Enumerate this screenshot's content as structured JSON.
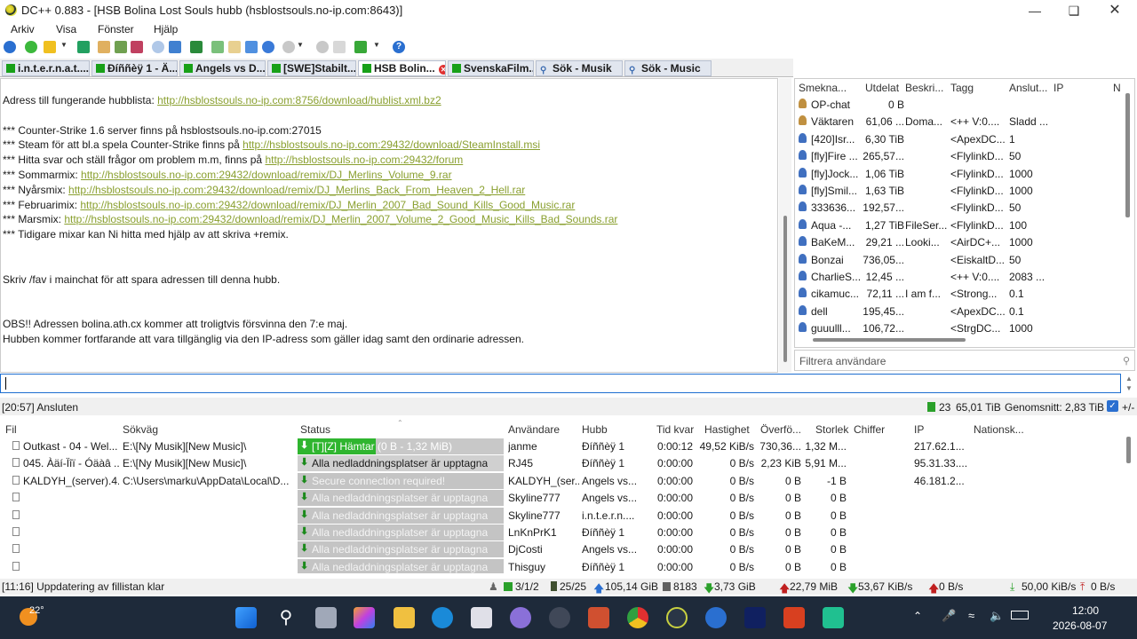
{
  "window": {
    "title": "DC++ 0.883 - [HSB Bolina Lost Souls hubb (hsblostsouls.no-ip.com:8643)]"
  },
  "menu": [
    "Arkiv",
    "Visa",
    "Fönster",
    "Hjälp"
  ],
  "tabs": [
    {
      "label": "i.n.t.e.r.n.a.t....",
      "kind": "hub"
    },
    {
      "label": "Ðíññèÿ 1 - Ä...",
      "kind": "hub"
    },
    {
      "label": "Angels vs D...",
      "kind": "hub"
    },
    {
      "label": "[SWE]Stabilt...",
      "kind": "hub"
    },
    {
      "label": "HSB Bolin...",
      "kind": "hub",
      "active": true
    },
    {
      "label": "SvenskaFilm...",
      "kind": "hub"
    },
    {
      "label": "Sök - Musik",
      "kind": "search"
    },
    {
      "label": "Sök - Music",
      "kind": "search"
    }
  ],
  "chat": {
    "lines": [
      {
        "t": "Adress till fungerande hubblista: ",
        "link": "http://hsblostsouls.no-ip.com:8756/download/hublist.xml.bz2"
      },
      {
        "t": ""
      },
      {
        "t": "*** Counter-Strike 1.6 server finns på hsblostsouls.no-ip.com:27015"
      },
      {
        "t": "*** Steam för att bl.a spela Counter-Strike finns på ",
        "link": "http://hsblostsouls.no-ip.com:29432/download/SteamInstall.msi"
      },
      {
        "t": "*** Hitta svar och ställ frågor om problem m.m, finns på ",
        "link": "http://hsblostsouls.no-ip.com:29432/forum"
      },
      {
        "t": "*** Sommarmix: ",
        "link": "http://hsblostsouls.no-ip.com:29432/download/remix/DJ_Merlins_Volume_9.rar"
      },
      {
        "t": "*** Nyårsmix: ",
        "link": "http://hsblostsouls.no-ip.com:29432/download/remix/DJ_Merlins_Back_From_Heaven_2_Hell.rar"
      },
      {
        "t": "*** Februarimix: ",
        "link": "http://hsblostsouls.no-ip.com:29432/download/remix/DJ_Merlin_2007_Bad_Sound_Kills_Good_Music.rar"
      },
      {
        "t": "*** Marsmix: ",
        "link": "http://hsblostsouls.no-ip.com:29432/download/remix/DJ_Merlin_2007_Volume_2_Good_Music_Kills_Bad_Sounds.rar"
      },
      {
        "t": "*** Tidigare mixar kan Ni hitta med hjälp av att skriva +remix."
      },
      {
        "t": ""
      },
      {
        "t": ""
      },
      {
        "t": "Skriv /fav i mainchat för att spara adressen till denna hubb."
      },
      {
        "t": ""
      },
      {
        "t": ""
      },
      {
        "t": "OBS!! Adressen bolina.ath.cx kommer att troligtvis försvinna den 7:e maj."
      },
      {
        "t": "Hubben kommer fortfarande att vara tillgänglig via den IP-adress som gäller idag samt den ordinarie adressen."
      }
    ]
  },
  "users": {
    "headers": [
      "Smekna...",
      "Utdelat",
      "Beskri...",
      "Tagg",
      "Anslut...",
      "IP",
      "N"
    ],
    "rows": [
      [
        "OP-chat",
        "0 B",
        "",
        "",
        "",
        ""
      ],
      [
        "Väktaren",
        "61,06 ...",
        "Doma...",
        "<++ V:0....",
        "Sladd ...",
        ""
      ],
      [
        "[420]Isr...",
        "6,30 TiB",
        "",
        "<ApexDC...",
        "1",
        ""
      ],
      [
        "[fly]Fire ...",
        "265,57...",
        "",
        "<FlylinkD...",
        "50",
        ""
      ],
      [
        "[fly]Jock...",
        "1,06 TiB",
        "",
        "<FlylinkD...",
        "1000",
        ""
      ],
      [
        "[fly]Smil...",
        "1,63 TiB",
        "",
        "<FlylinkD...",
        "1000",
        ""
      ],
      [
        "333636...",
        "192,57...",
        "",
        "<FlylinkD...",
        "50",
        ""
      ],
      [
        "Aqua -...",
        "1,27 TiB",
        "FileSer...",
        "<FlylinkD...",
        "100",
        ""
      ],
      [
        "BaKeM...",
        "29,21 ...",
        "Looki...",
        "<AirDC+...",
        "1000",
        ""
      ],
      [
        "Bonzai",
        "736,05...",
        "",
        "<EiskaltD...",
        "50",
        ""
      ],
      [
        "CharlieS...",
        "12,45 ...",
        "",
        "<++ V:0....",
        "2083 ...",
        ""
      ],
      [
        "cikamuc...",
        "72,11 ...",
        "I am f...",
        "<Strong...",
        "0.1",
        ""
      ],
      [
        "dell",
        "195,45...",
        "",
        "<ApexDC...",
        "0.1",
        ""
      ],
      [
        "guuulll...",
        "106,72...",
        "",
        "<StrgDC...",
        "1000",
        ""
      ]
    ],
    "filter_placeholder": "Filtrera användare"
  },
  "status_top": {
    "time_msg": "[20:57] Ansluten",
    "users": "23",
    "shared": "65,01 TiB",
    "avg": "Genomsnitt: 2,83 TiB",
    "plusminus": "+/-"
  },
  "transfers": {
    "headers": [
      "Fil",
      "Sökväg",
      "Status",
      "Användare",
      "Hubb",
      "Tid kvar",
      "Hastighet",
      "Överfö...",
      "Storlek",
      "Chiffer",
      "IP",
      "Nationsk..."
    ],
    "rows": [
      {
        "fil": "Outkast - 04 - Wel...",
        "path": "E:\\[Ny Musik][New Music]\\",
        "status": "[T][Z] Hämtar (0 B - 1,32 MiB)",
        "kind": "active",
        "progress": 0.38,
        "user": "janme",
        "hub": "Ðíññèÿ 1",
        "left": "0:00:12",
        "speed": "49,52 KiB/s",
        "trans": "730,36...",
        "size": "1,32 M...",
        "ip": "217.62.1..."
      },
      {
        "fil": "045. Àäí-Ïîï - Óäàâ ...",
        "path": "E:\\[Ny Musik][New Music]\\",
        "status": "Alla nedladdningsplatser är upptagna",
        "kind": "waiting",
        "user": "RJ45",
        "hub": "Ðíññèÿ 1",
        "left": "0:00:00",
        "speed": "0 B/s",
        "trans": "2,23 KiB",
        "size": "5,91 M...",
        "ip": "95.31.33...."
      },
      {
        "fil": "KALDYH_(server).4...",
        "path": "C:\\Users\\marku\\AppData\\Local\\D...",
        "status": "Secure connection required!",
        "kind": "error",
        "user": "KALDYH_(ser...",
        "hub": "Angels vs...",
        "left": "0:00:00",
        "speed": "0 B/s",
        "trans": "0 B",
        "size": "-1 B",
        "ip": "46.181.2..."
      },
      {
        "fil": "",
        "path": "",
        "status": "Alla nedladdningsplatser är upptagna",
        "kind": "grey",
        "user": "Skyline777",
        "hub": "Angels vs...",
        "left": "0:00:00",
        "speed": "0 B/s",
        "trans": "0 B",
        "size": "0 B",
        "ip": ""
      },
      {
        "fil": "",
        "path": "",
        "status": "Alla nedladdningsplatser är upptagna",
        "kind": "grey",
        "user": "Skyline777",
        "hub": "i.n.t.e.r.n....",
        "left": "0:00:00",
        "speed": "0 B/s",
        "trans": "0 B",
        "size": "0 B",
        "ip": ""
      },
      {
        "fil": "",
        "path": "",
        "status": "Alla nedladdningsplatser är upptagna",
        "kind": "grey",
        "user": "LnKnPrK1",
        "hub": "Ðíññèÿ 1",
        "left": "0:00:00",
        "speed": "0 B/s",
        "trans": "0 B",
        "size": "0 B",
        "ip": ""
      },
      {
        "fil": "",
        "path": "",
        "status": "Alla nedladdningsplatser är upptagna",
        "kind": "grey",
        "user": "DjCosti",
        "hub": "Angels vs...",
        "left": "0:00:00",
        "speed": "0 B/s",
        "trans": "0 B",
        "size": "0 B",
        "ip": ""
      },
      {
        "fil": "",
        "path": "",
        "status": "Alla nedladdningsplatser är upptagna",
        "kind": "grey",
        "user": "Thisguy",
        "hub": "Ðíññèÿ 1",
        "left": "0:00:00",
        "speed": "0 B/s",
        "trans": "0 B",
        "size": "0 B",
        "ip": ""
      }
    ]
  },
  "status_bottom": {
    "msg": "[11:16] Uppdatering av fillistan klar",
    "slots": "3/1/2",
    "d_slots": "25/25",
    "shared": "105,14 GiB",
    "files": "8183",
    "down_total": "3,73 GiB",
    "up_total": "22,79 MiB",
    "down_rate": "53,67 KiB/s",
    "up_rate": "0 B/s",
    "down_limit": "50,00 KiB/s",
    "up_limit": "0 B/s"
  },
  "taskbar": {
    "weather": "22°",
    "time": "12:00",
    "date": "2026-08-07"
  },
  "colors": {
    "link": "#8aa030",
    "progress": "#2fb52f",
    "waiting": "#c8c8c8",
    "accent": "#1e6ed0"
  }
}
